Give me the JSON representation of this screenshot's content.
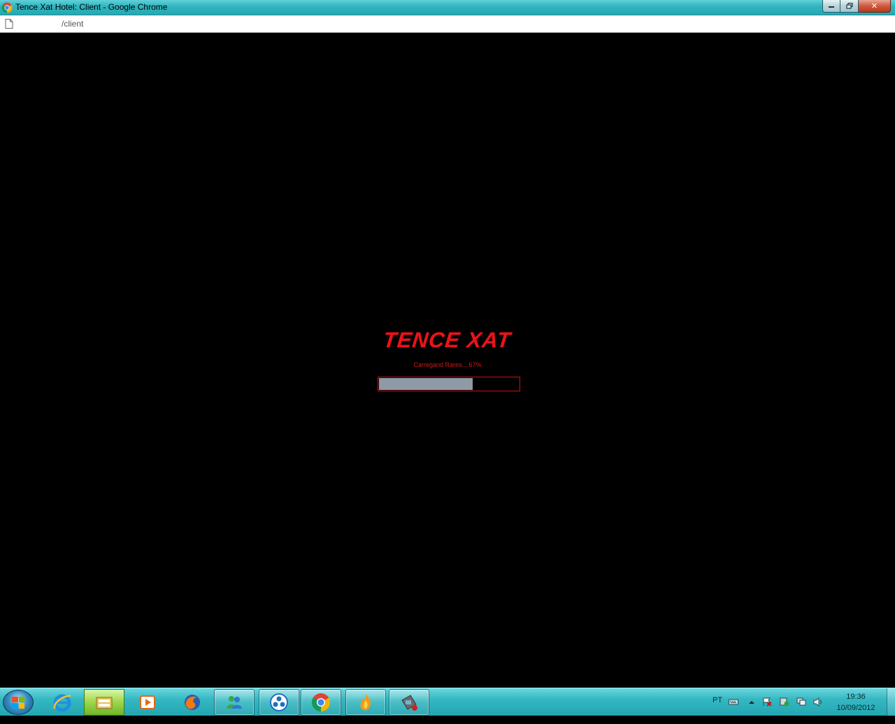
{
  "window": {
    "title": "Tence Xat Hotel: Client - Google Chrome",
    "minimize_label": "",
    "restore_label": "",
    "close_label": "✕"
  },
  "addressbar": {
    "url": "/client"
  },
  "client": {
    "logo_text": "TENCE XAT",
    "loading_text": "Carregand Rares... 67%",
    "progress": 0.67,
    "accent_color": "#e8141a",
    "progress_fill_color": "#8e9aa6"
  },
  "taskbar": {
    "start_icon": "windows-start-icon",
    "items": [
      {
        "name": "internet-explorer",
        "icon": "ie-icon"
      },
      {
        "name": "windows-explorer",
        "icon": "folder-icon"
      },
      {
        "name": "media-player",
        "icon": "media-player-icon"
      },
      {
        "name": "firefox",
        "icon": "firefox-icon"
      },
      {
        "name": "messenger",
        "icon": "messenger-icon"
      },
      {
        "name": "app-blue",
        "icon": "circles-icon"
      },
      {
        "name": "google-chrome",
        "icon": "chrome-icon"
      },
      {
        "name": "flame-app",
        "icon": "flame-icon"
      },
      {
        "name": "utility",
        "icon": "tool-icon"
      }
    ],
    "language": "PT",
    "clock_time": "19:36",
    "clock_date": "10/09/2012"
  }
}
